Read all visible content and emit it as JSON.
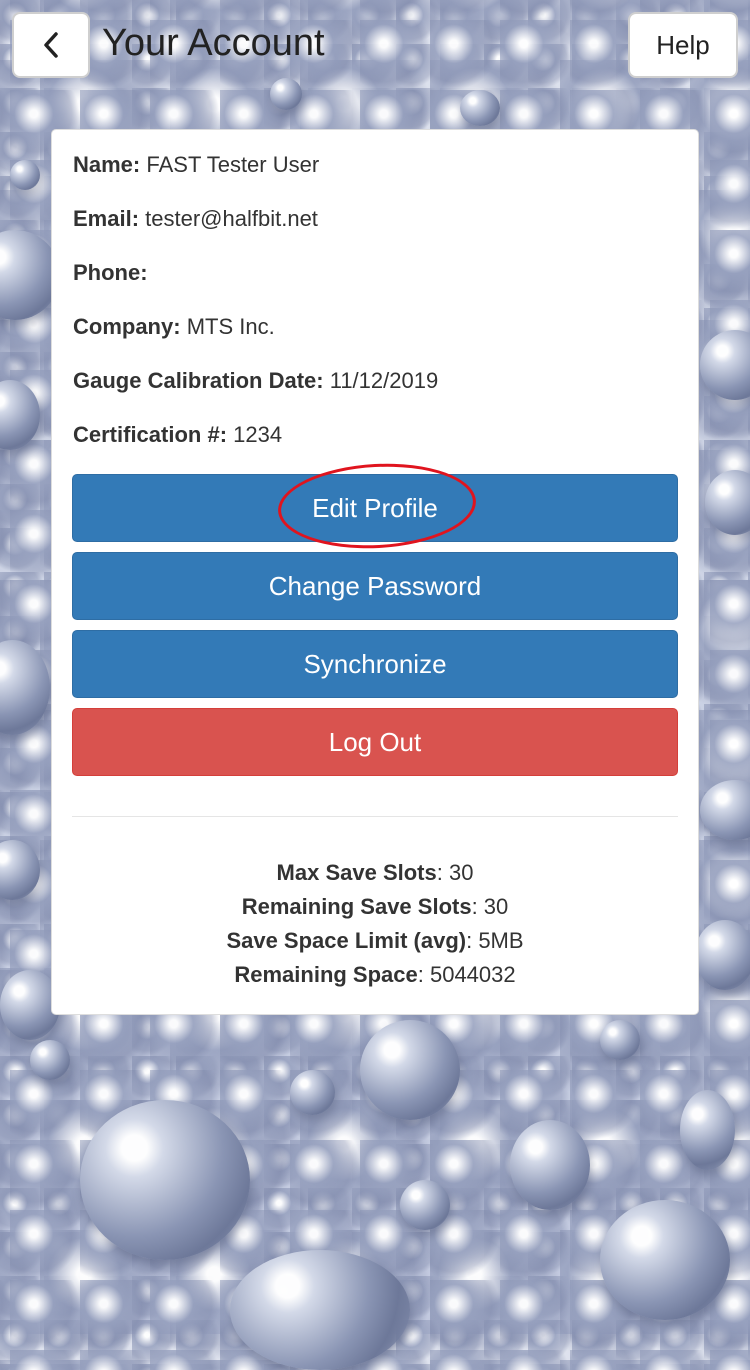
{
  "header": {
    "title": "Your Account",
    "back_icon": "chevron-left-icon",
    "help_label": "Help"
  },
  "profile": {
    "name_label": "Name:",
    "name_value": "FAST Tester User",
    "email_label": "Email:",
    "email_value": "tester@halfbit.net",
    "phone_label": "Phone:",
    "phone_value": "",
    "company_label": "Company:",
    "company_value": "MTS Inc.",
    "calibration_label": "Gauge Calibration Date:",
    "calibration_value": "11/12/2019",
    "certification_label": "Certification #:",
    "certification_value": "1234"
  },
  "actions": {
    "edit_profile": "Edit Profile",
    "change_password": "Change Password",
    "synchronize": "Synchronize",
    "log_out": "Log Out"
  },
  "colors": {
    "primary_button": "#337ab7",
    "danger_button": "#d9534f",
    "highlight_circle": "#e0141e"
  },
  "storage": {
    "max_slots_label": "Max Save Slots",
    "max_slots_value": ": 30",
    "remaining_slots_label": "Remaining Save Slots",
    "remaining_slots_value": ": 30",
    "space_limit_label": "Save Space Limit (avg)",
    "space_limit_value": ": 5MB",
    "remaining_space_label": "Remaining Space",
    "remaining_space_value": ": 5044032"
  }
}
